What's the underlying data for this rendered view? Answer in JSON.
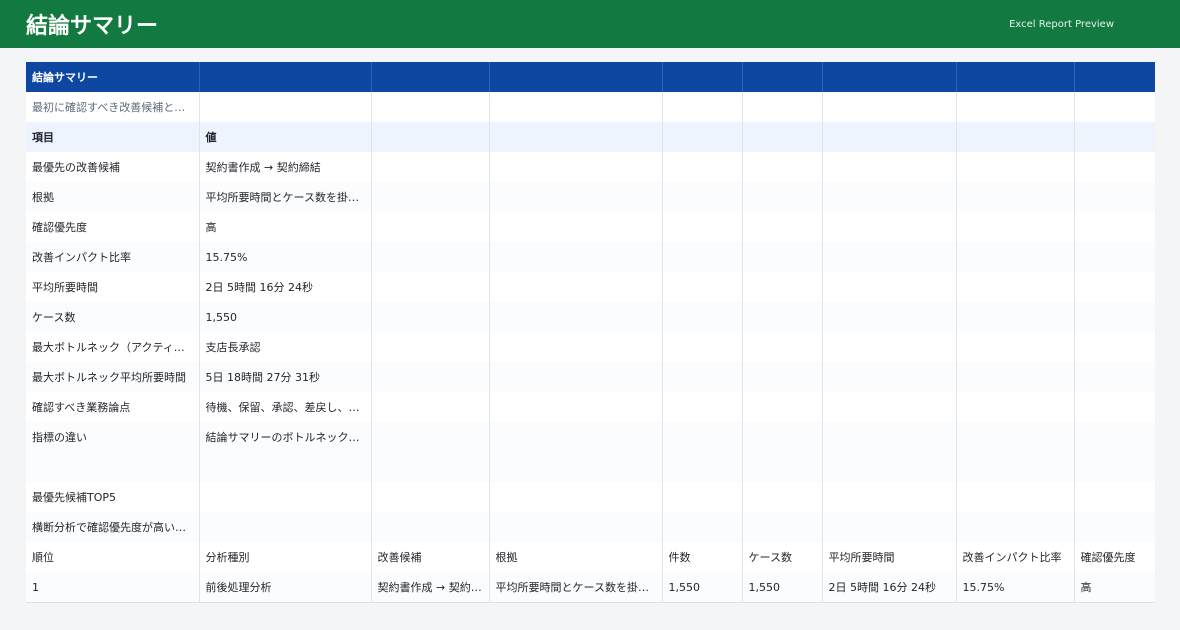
{
  "header": {
    "title": "結論サマリー",
    "label": "Excel Report Preview"
  },
  "sheet": {
    "title": "結論サマリー",
    "note": "最初に確認すべき改善候補とボトルネックの要約",
    "kv_headers": [
      "項目",
      "値"
    ],
    "kv_rows": [
      {
        "key": "最優先の改善候補",
        "value": "契約書作成 → 契約締結"
      },
      {
        "key": "根拠",
        "value": "平均所要時間とケース数を掛け合わせた改善インパクトが最も大きい"
      },
      {
        "key": "確認優先度",
        "value": "高"
      },
      {
        "key": "改善インパクト比率",
        "value": "15.75%"
      },
      {
        "key": "平均所要時間",
        "value": "2日 5時間 16分 24秒"
      },
      {
        "key": "ケース数",
        "value": "1,550"
      },
      {
        "key": "最大ボトルネック（アクティビティ）",
        "value": "支店長承認"
      },
      {
        "key": "最大ボトルネック平均所要時間",
        "value": "5日 18時間 27分 31秒"
      },
      {
        "key": "確認すべき業務論点",
        "value": "待機、保留、承認、差戻し、例外処理"
      },
      {
        "key": "指標の違い",
        "value": "結論サマリーのボトルネック候補は平均所要時間で算出"
      }
    ],
    "top5_label": "最優先候補TOP5",
    "top5_note": "横断分析で確認優先度が高い候補",
    "table_headers": [
      "順位",
      "分析種別",
      "改善候補",
      "根拠",
      "件数",
      "ケース数",
      "平均所要時間",
      "改善インパクト比率",
      "確認優先度"
    ],
    "table_rows": [
      [
        "1",
        "前後処理分析",
        "契約書作成 → 契約締結",
        "平均所要時間とケース数を掛け合わせた改善インパクト",
        "1,550",
        "1,550",
        "2日 5時間 16分 24秒",
        "15.75%",
        "高"
      ]
    ]
  }
}
